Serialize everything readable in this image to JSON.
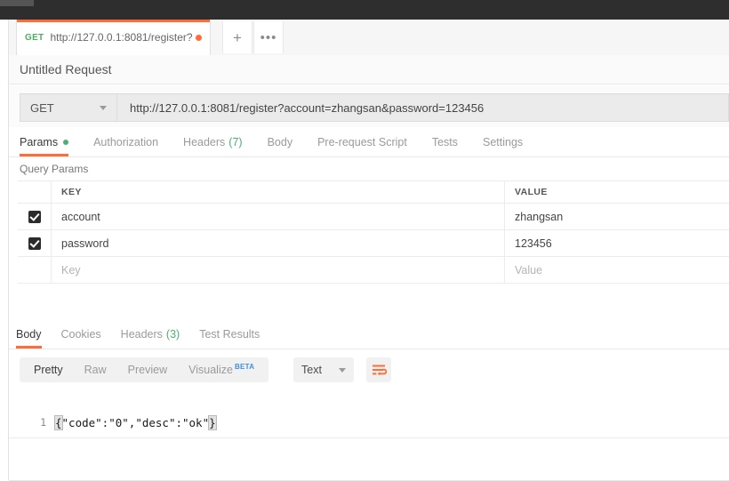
{
  "window": {
    "titlebar_color": "#2e2e2e"
  },
  "tabstrip": {
    "tab": {
      "method": "GET",
      "url": "http://127.0.0.1:8081/register?a...",
      "unsaved_dot": true
    },
    "new_tab_label": "+",
    "more_label": "•••"
  },
  "request": {
    "title": "Untitled Request",
    "method": "GET",
    "url": "http://127.0.0.1:8081/register?account=zhangsan&password=123456",
    "tabs": [
      {
        "label": "Params",
        "active": true,
        "dot": true
      },
      {
        "label": "Authorization",
        "active": false
      },
      {
        "label": "Headers",
        "count": "(7)",
        "active": false
      },
      {
        "label": "Body",
        "active": false
      },
      {
        "label": "Pre-request Script",
        "active": false
      },
      {
        "label": "Tests",
        "active": false
      },
      {
        "label": "Settings",
        "active": false
      }
    ]
  },
  "query_params": {
    "section_label": "Query Params",
    "columns": {
      "key": "KEY",
      "value": "VALUE"
    },
    "rows": [
      {
        "checked": true,
        "key": "account",
        "value": "zhangsan"
      },
      {
        "checked": true,
        "key": "password",
        "value": "123456"
      }
    ],
    "placeholder_row": {
      "key": "Key",
      "value": "Value"
    }
  },
  "response": {
    "tabs": [
      {
        "label": "Body",
        "active": true
      },
      {
        "label": "Cookies",
        "active": false
      },
      {
        "label": "Headers",
        "count": "(3)",
        "active": false
      },
      {
        "label": "Test Results",
        "active": false
      }
    ],
    "format_tabs": [
      {
        "label": "Pretty",
        "active": true
      },
      {
        "label": "Raw",
        "active": false
      },
      {
        "label": "Preview",
        "active": false
      },
      {
        "label": "Visualize",
        "active": false,
        "badge": "BETA"
      }
    ],
    "type_select": "Text",
    "wrap_lines_icon": "wrap-lines-icon",
    "body": {
      "line_number": "1",
      "open_brace": "{",
      "content": "\"code\":\"0\",\"desc\":\"ok\"",
      "close_brace": "}"
    }
  },
  "colors": {
    "accent": "#ff6c37",
    "green": "#4caf72",
    "blue": "#3f90e0"
  }
}
